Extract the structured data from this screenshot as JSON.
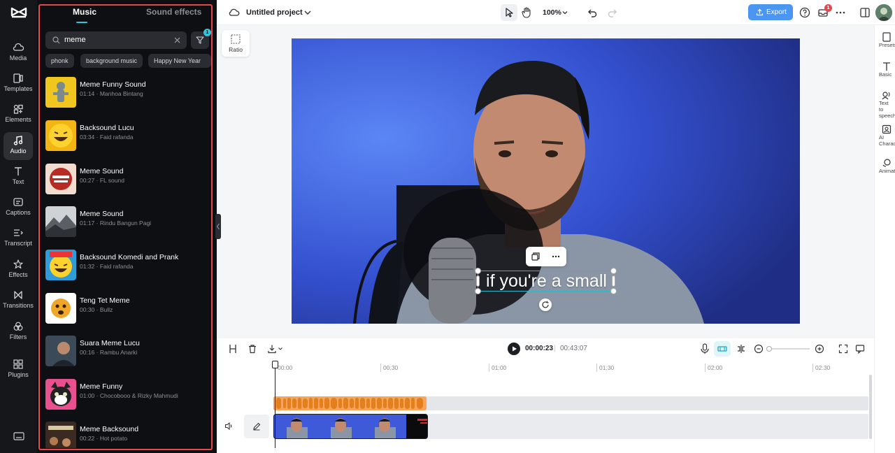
{
  "rail": {
    "items": [
      {
        "label": "Media",
        "icon": "media-icon"
      },
      {
        "label": "Templates",
        "icon": "templates-icon"
      },
      {
        "label": "Elements",
        "icon": "elements-icon"
      },
      {
        "label": "Audio",
        "icon": "audio-icon"
      },
      {
        "label": "Text",
        "icon": "text-icon"
      },
      {
        "label": "Captions",
        "icon": "captions-icon"
      },
      {
        "label": "Transcript",
        "icon": "transcript-icon"
      },
      {
        "label": "Effects",
        "icon": "effects-icon"
      },
      {
        "label": "Transitions",
        "icon": "transitions-icon"
      },
      {
        "label": "Filters",
        "icon": "filters-icon"
      },
      {
        "label": "Plugins",
        "icon": "plugins-icon"
      }
    ],
    "active": "Audio"
  },
  "panel": {
    "tabs": {
      "music": "Music",
      "sound_effects": "Sound effects"
    },
    "search": {
      "value": "meme",
      "filter_badge": "1"
    },
    "chips": [
      "phonk",
      "background music",
      "Happy New Year"
    ],
    "tracks": [
      {
        "title": "Meme Funny Sound",
        "meta": "01:14 · Manhoa Bintang"
      },
      {
        "title": "Backsound Lucu",
        "meta": "03:34 · Faid rafanda"
      },
      {
        "title": "Meme Sound",
        "meta": "00:27 · FL sound"
      },
      {
        "title": "Meme Sound",
        "meta": "01:17 · Rindu Bangun Pagi"
      },
      {
        "title": "Backsound Komedi and Prank",
        "meta": "01:32 · Faid rafanda"
      },
      {
        "title": "Teng Tet Meme",
        "meta": "00:30 · Bullz"
      },
      {
        "title": "Suara Meme Lucu",
        "meta": "00:16 · Rambu Anarki"
      },
      {
        "title": "Meme Funny",
        "meta": "01:00 · Chocobooo & Rizky Mahmudi"
      },
      {
        "title": "Meme Backsound",
        "meta": "00:22 · Hot potato"
      }
    ]
  },
  "topbar": {
    "project_title": "Untitled project",
    "zoom": "100%",
    "export_label": "Export",
    "notification_count": "1"
  },
  "canvas": {
    "ratio_label": "Ratio",
    "caption_text": "if you're a small"
  },
  "right_rail": {
    "items": [
      {
        "label": "Presets"
      },
      {
        "label": "Basic"
      },
      {
        "label": "Text to speech"
      },
      {
        "label": "AI Charac..."
      },
      {
        "label": "Animat..."
      }
    ]
  },
  "timeline": {
    "current_time": "00:00:23",
    "separator": "|",
    "total_time": "00:43:07",
    "ruler": [
      "00:00",
      "00:30",
      "01:00",
      "01:30",
      "02:00",
      "02:30"
    ]
  },
  "colors": {
    "accent": "#2fc7d8",
    "export": "#4a96f2",
    "highlight_outline": "#e5484d",
    "audio_clip": "#f2a25a"
  }
}
